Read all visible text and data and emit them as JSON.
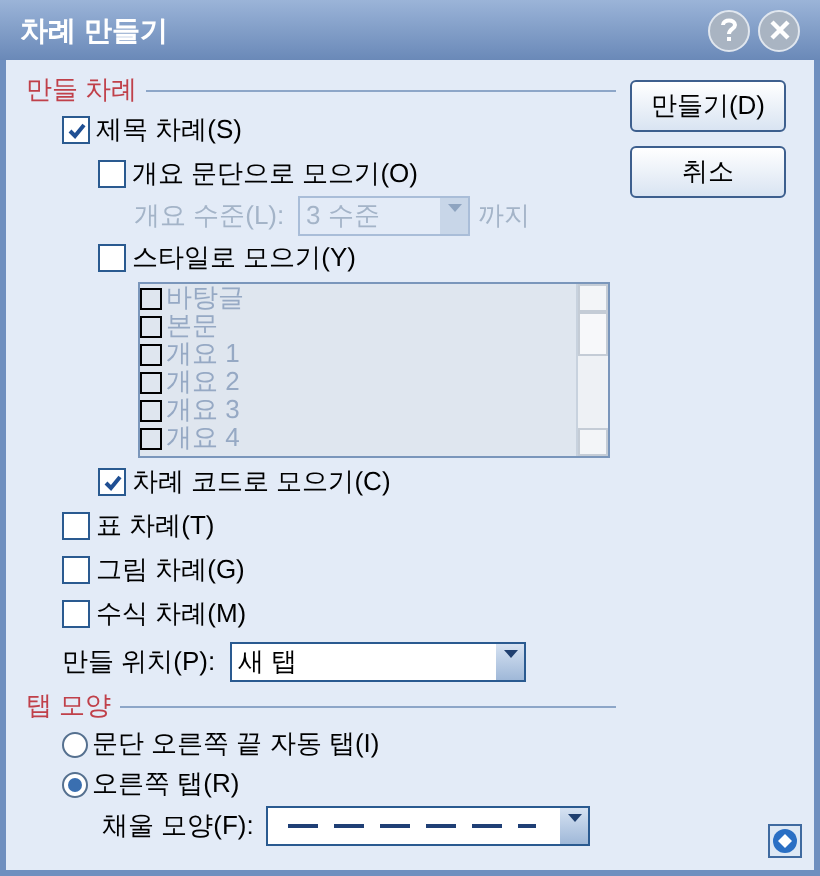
{
  "window": {
    "title": "차례 만들기"
  },
  "buttons": [
    {
      "label": "만들기(D)"
    },
    {
      "label": "취소"
    }
  ],
  "create_section": {
    "title": "만들 차례",
    "options": [
      {
        "kind": "checkbox",
        "label": "제목 차례(S)",
        "checked": true,
        "children": [
          {
            "kind": "checkbox",
            "label": "개요 문단으로 모으기(O)",
            "checked": false
          },
          {
            "kind": "level",
            "label": "개요 수준(L):",
            "value": "3 수준",
            "suffix": "까지",
            "disabled": true
          },
          {
            "kind": "checkbox",
            "label": "스타일로 모으기(Y)",
            "checked": false
          },
          {
            "kind": "stylelist",
            "disabled": true,
            "items": [
              {
                "label": "바탕글",
                "checked": false
              },
              {
                "label": "본문",
                "checked": false
              },
              {
                "label": "개요 1",
                "checked": false
              },
              {
                "label": "개요 2",
                "checked": false
              },
              {
                "label": "개요 3",
                "checked": false
              },
              {
                "label": "개요 4",
                "checked": false
              }
            ]
          },
          {
            "kind": "checkbox",
            "label": "차례 코드로 모으기(C)",
            "checked": true
          }
        ]
      },
      {
        "kind": "checkbox",
        "label": "표 차례(T)",
        "checked": false
      },
      {
        "kind": "checkbox",
        "label": "그림 차례(G)",
        "checked": false
      },
      {
        "kind": "checkbox",
        "label": "수식 차례(M)",
        "checked": false
      }
    ],
    "location": {
      "label": "만들 위치(P):",
      "value": "새 탭"
    }
  },
  "tab_section": {
    "title": "탭 모양",
    "options": [
      {
        "label": "문단 오른쪽 끝 자동 탭(I)",
        "selected": false
      },
      {
        "label": "오른쪽 탭(R)",
        "selected": true
      }
    ],
    "fill": {
      "label": "채울 모양(F):"
    }
  }
}
